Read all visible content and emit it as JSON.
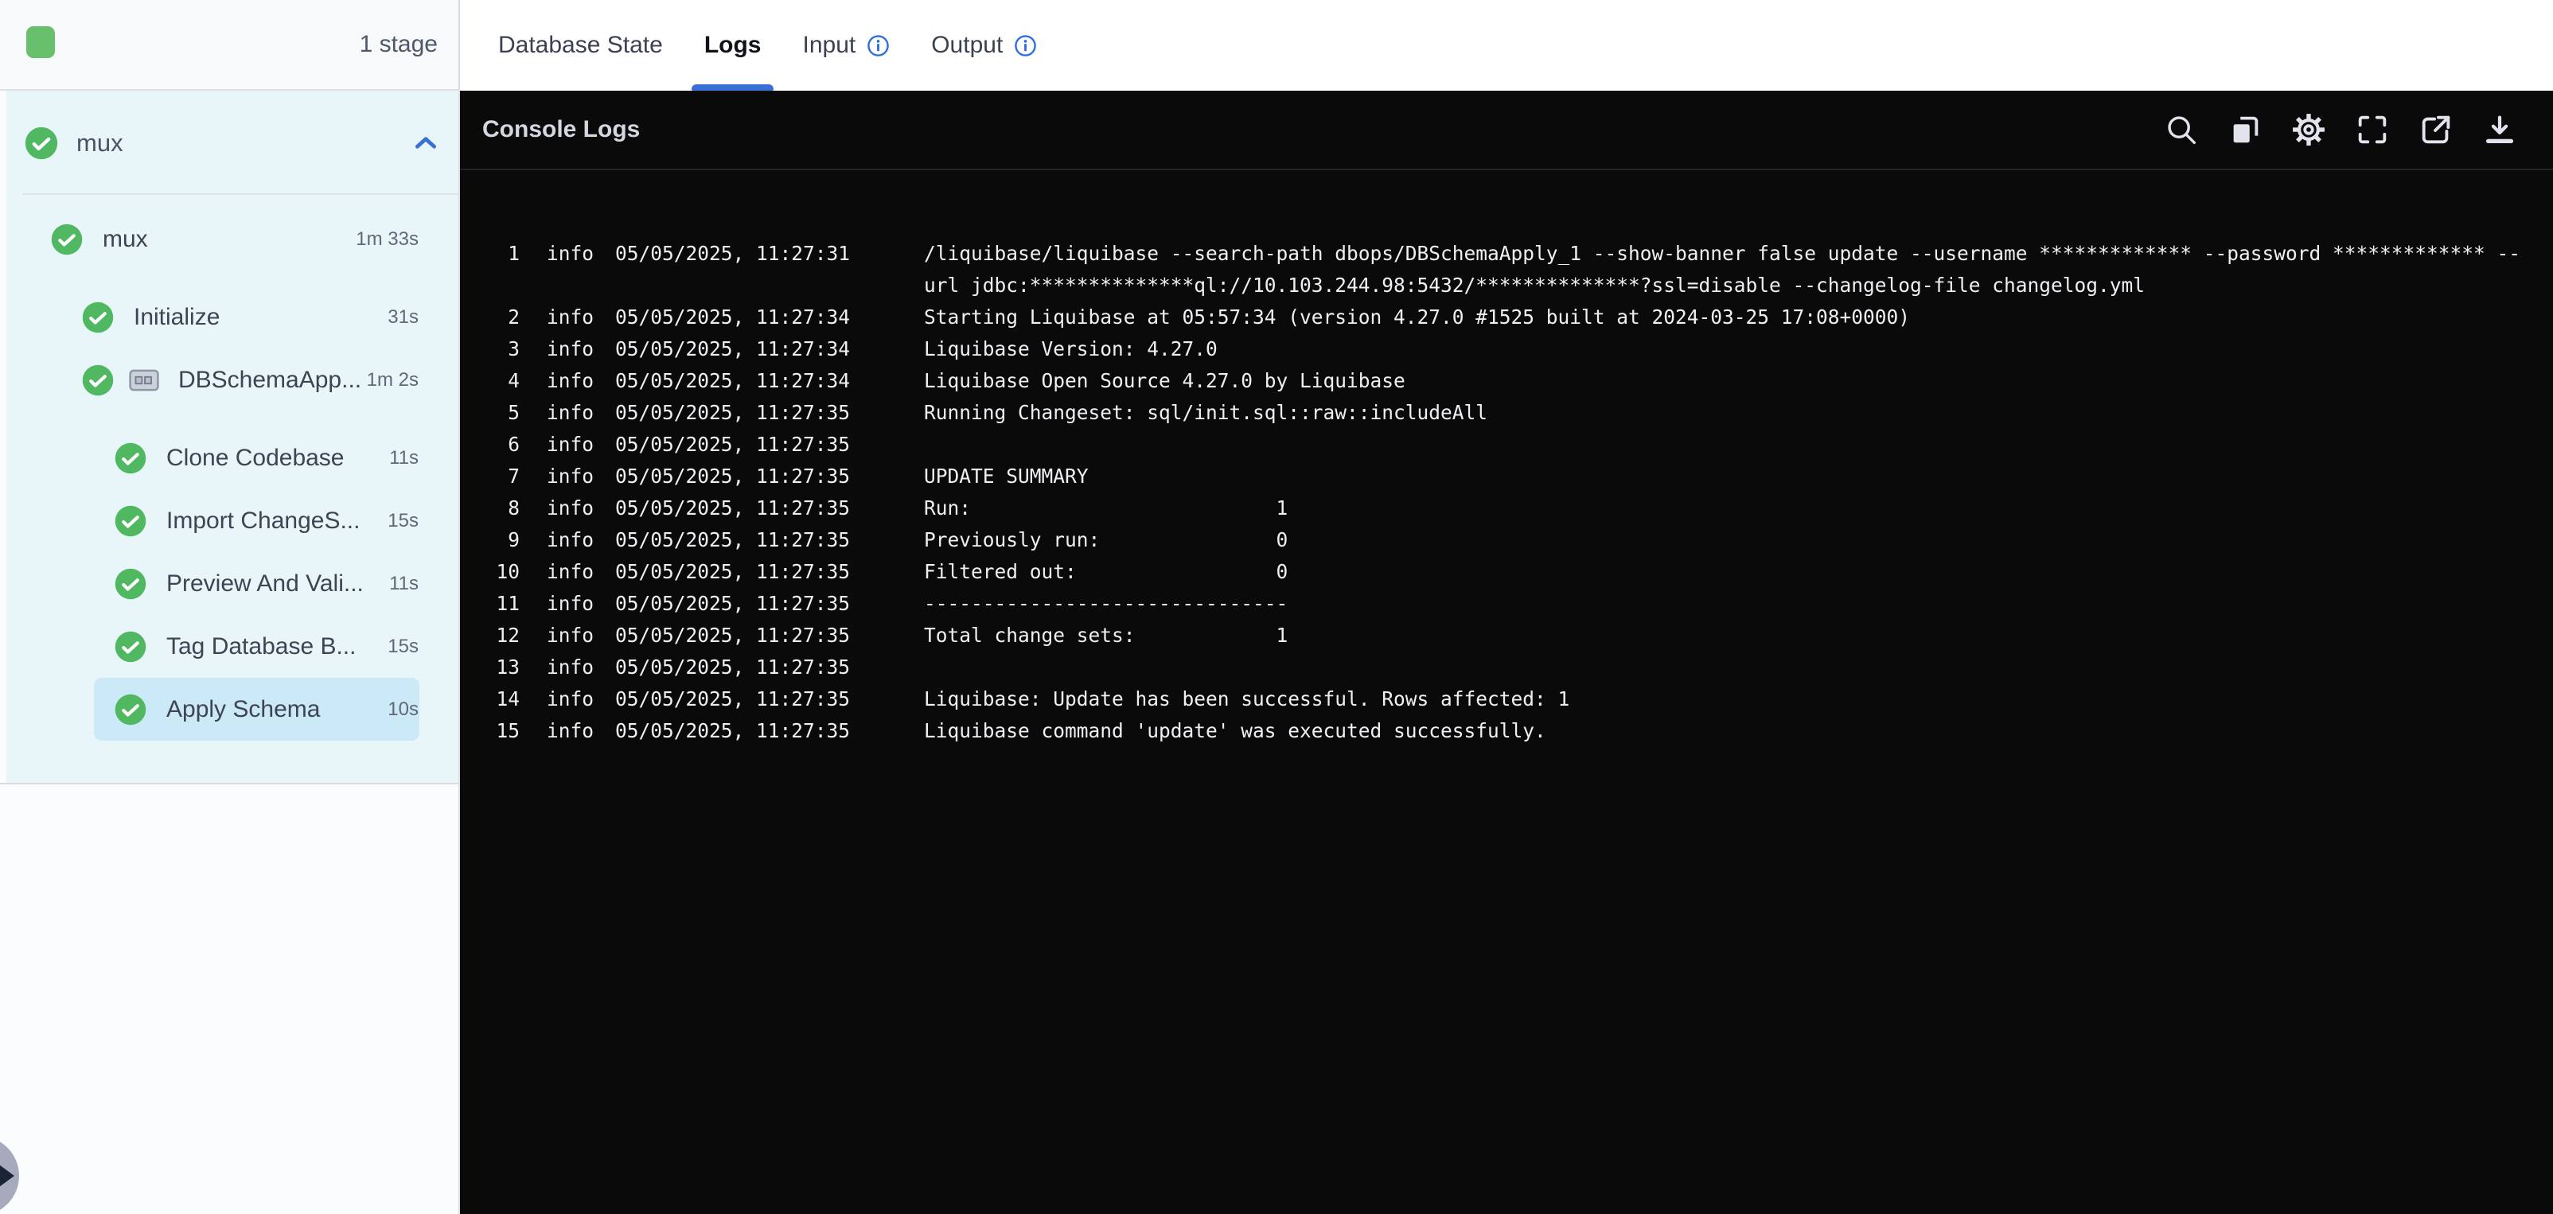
{
  "pipeline_bar": {
    "stage_count": "1 stage"
  },
  "tabs": {
    "items": [
      {
        "label": "Database State",
        "active": false,
        "info_icon": false
      },
      {
        "label": "Logs",
        "active": true,
        "info_icon": false
      },
      {
        "label": "Input",
        "active": false,
        "info_icon": true
      },
      {
        "label": "Output",
        "active": false,
        "info_icon": true
      }
    ]
  },
  "sidebar": {
    "header": {
      "title": "mux",
      "status": "success"
    },
    "tree": [
      {
        "label": "mux",
        "duration": "1m 33s",
        "indent": 1,
        "status": "success"
      },
      {
        "label": "Initialize",
        "duration": "31s",
        "indent": 2,
        "status": "success",
        "gap_before": true
      },
      {
        "label": "DBSchemaApp...",
        "duration": "1m 2s",
        "indent": 2,
        "status": "success",
        "icon": "step-group-icon"
      },
      {
        "label": "Clone Codebase",
        "duration": "11s",
        "indent": 3,
        "status": "success",
        "gap_before": true
      },
      {
        "label": "Import ChangeS...",
        "duration": "15s",
        "indent": 3,
        "status": "success"
      },
      {
        "label": "Preview And Vali...",
        "duration": "11s",
        "indent": 3,
        "status": "success"
      },
      {
        "label": "Tag Database B...",
        "duration": "15s",
        "indent": 3,
        "status": "success"
      },
      {
        "label": "Apply Schema",
        "duration": "10s",
        "indent": 3,
        "status": "success",
        "selected": true
      }
    ]
  },
  "console": {
    "title": "Console Logs",
    "toolbar_icons": [
      "search-icon",
      "copy-icon",
      "settings-icon",
      "fullscreen-icon",
      "open-in-new-icon",
      "download-icon"
    ],
    "logs": [
      {
        "n": "1",
        "level": "info",
        "time": "05/05/2025, 11:27:31",
        "lines": [
          "/liquibase/liquibase --search-path dbops/DBSchemaApply_1 --show-banner false update --username ************* --password ************* --",
          "url jdbc:**************ql://10.103.244.98:5432/**************?ssl=disable --changelog-file changelog.yml"
        ]
      },
      {
        "n": "2",
        "level": "info",
        "time": "05/05/2025, 11:27:34",
        "lines": [
          "Starting Liquibase at 05:57:34 (version 4.27.0 #1525 built at 2024-03-25 17:08+0000)"
        ]
      },
      {
        "n": "3",
        "level": "info",
        "time": "05/05/2025, 11:27:34",
        "lines": [
          "Liquibase Version: 4.27.0"
        ]
      },
      {
        "n": "4",
        "level": "info",
        "time": "05/05/2025, 11:27:34",
        "lines": [
          "Liquibase Open Source 4.27.0 by Liquibase"
        ]
      },
      {
        "n": "5",
        "level": "info",
        "time": "05/05/2025, 11:27:35",
        "lines": [
          "Running Changeset: sql/init.sql::raw::includeAll"
        ]
      },
      {
        "n": "6",
        "level": "info",
        "time": "05/05/2025, 11:27:35",
        "lines": [
          ""
        ]
      },
      {
        "n": "7",
        "level": "info",
        "time": "05/05/2025, 11:27:35",
        "lines": [
          "UPDATE SUMMARY"
        ]
      },
      {
        "n": "8",
        "level": "info",
        "time": "05/05/2025, 11:27:35",
        "lines": [
          "Run:                          1"
        ]
      },
      {
        "n": "9",
        "level": "info",
        "time": "05/05/2025, 11:27:35",
        "lines": [
          "Previously run:               0"
        ]
      },
      {
        "n": "10",
        "level": "info",
        "time": "05/05/2025, 11:27:35",
        "lines": [
          "Filtered out:                 0"
        ]
      },
      {
        "n": "11",
        "level": "info",
        "time": "05/05/2025, 11:27:35",
        "lines": [
          "-------------------------------"
        ]
      },
      {
        "n": "12",
        "level": "info",
        "time": "05/05/2025, 11:27:35",
        "lines": [
          "Total change sets:            1"
        ]
      },
      {
        "n": "13",
        "level": "info",
        "time": "05/05/2025, 11:27:35",
        "lines": [
          ""
        ]
      },
      {
        "n": "14",
        "level": "info",
        "time": "05/05/2025, 11:27:35",
        "lines": [
          "Liquibase: Update has been successful. Rows affected: 1"
        ]
      },
      {
        "n": "15",
        "level": "info",
        "time": "05/05/2025, 11:27:35",
        "lines": [
          "Liquibase command 'update' was executed successfully."
        ]
      }
    ]
  },
  "colors": {
    "accent_blue": "#3a6fd8",
    "success_green": "#50b860",
    "stage_chip_green": "#68bf6c",
    "tree_panel_bg": "#e8f5f9",
    "selected_row_bg": "#cbe9f6",
    "console_bg": "#0a0a0b"
  }
}
